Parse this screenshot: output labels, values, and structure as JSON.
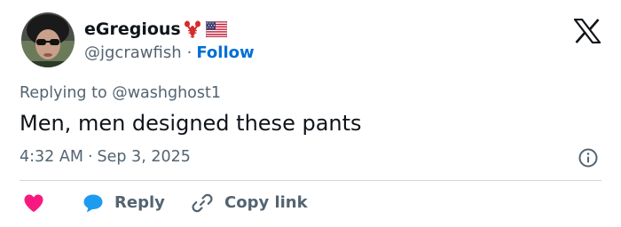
{
  "author": {
    "display_name": "eGregious",
    "handle": "@jgcrawfish",
    "follow_label": "Follow",
    "separator": "·",
    "badges": [
      "lobster-emoji-icon",
      "us-flag-icon"
    ]
  },
  "reply_context": {
    "text": "Replying to @washghost1"
  },
  "tweet": {
    "text": "Men, men designed these pants"
  },
  "meta": {
    "time": "4:32 AM",
    "separator": "·",
    "date": "Sep 3, 2025"
  },
  "actions": {
    "like_icon": "heart-icon",
    "reply_label": "Reply",
    "copy_link_label": "Copy link"
  },
  "colors": {
    "text": "#0f1419",
    "secondary": "#536471",
    "follow": "#006fd6",
    "like": "#f91880",
    "reply_bubble": "#1d9bf0",
    "divider": "#cfd9de"
  }
}
